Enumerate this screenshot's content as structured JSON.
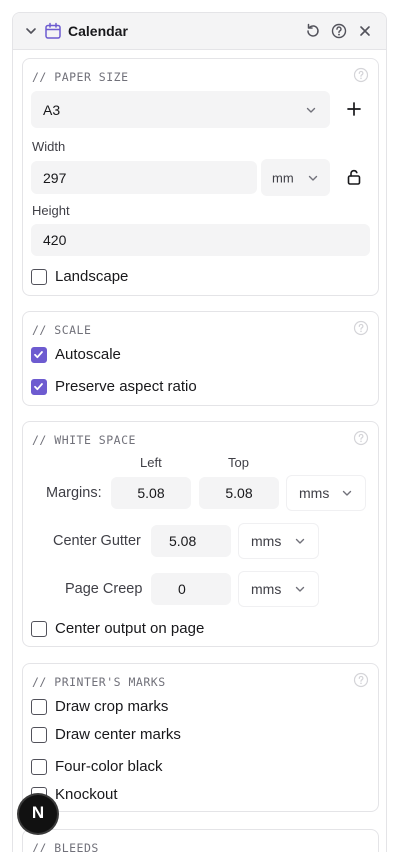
{
  "header": {
    "title": "Calendar",
    "icons": [
      "chevron-down-icon",
      "calendar-icon",
      "reset-icon",
      "help-icon",
      "close-icon"
    ],
    "accent": "#6d5bd0"
  },
  "paper_size": {
    "title": "// PAPER SIZE",
    "preset": "A3",
    "width_label": "Width",
    "width_value": "297",
    "unit": "mm",
    "height_label": "Height",
    "height_value": "420",
    "landscape_label": "Landscape",
    "landscape_checked": false
  },
  "scale": {
    "title": "// SCALE",
    "autoscale_label": "Autoscale",
    "autoscale_checked": true,
    "preserve_label": "Preserve aspect ratio",
    "preserve_checked": true
  },
  "white_space": {
    "title": "// WHITE SPACE",
    "left_label": "Left",
    "top_label": "Top",
    "margins_label": "Margins:",
    "margin_left": "5.08",
    "margin_top": "5.08",
    "margins_unit": "mms",
    "gutter_label": "Center Gutter",
    "gutter_value": "5.08",
    "gutter_unit": "mms",
    "creep_label": "Page Creep",
    "creep_value": "0",
    "creep_unit": "mms",
    "center_label": "Center output on page",
    "center_checked": false
  },
  "printers_marks": {
    "title": "// PRINTER'S MARKS",
    "crop_label": "Draw crop marks",
    "center_marks_label": "Draw center marks",
    "fourcolor_label": "Four-color black",
    "knockout_label": "Knockout"
  },
  "bleeds": {
    "title": "// BLEEDS"
  },
  "fab": {
    "letter": "N"
  }
}
